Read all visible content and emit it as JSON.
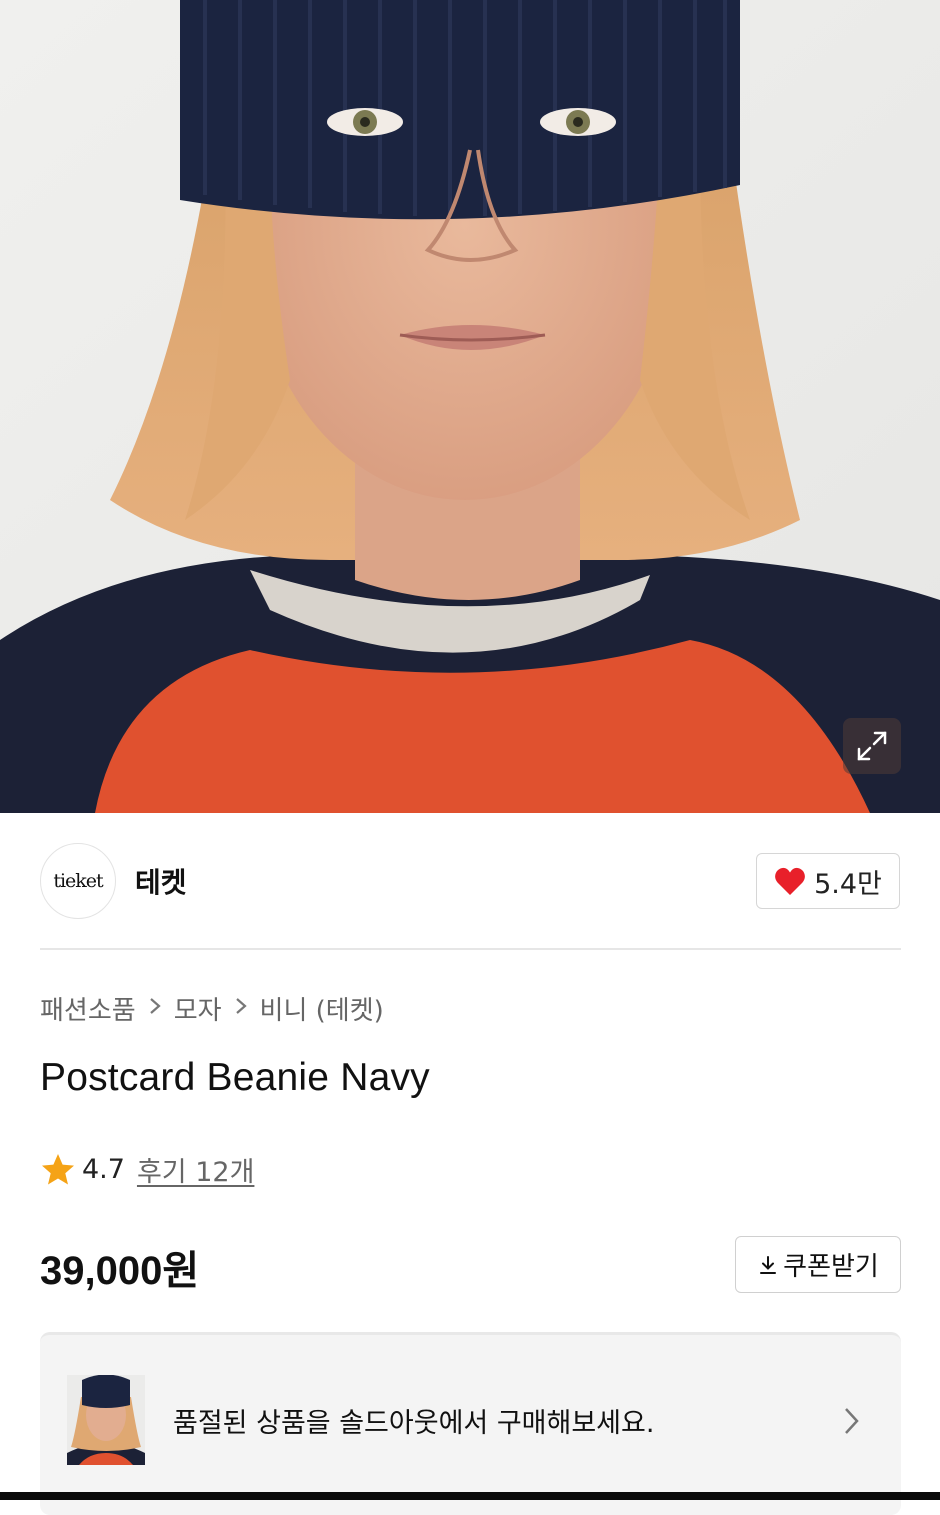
{
  "brand": {
    "logo_text": "tieket",
    "name": "테켓"
  },
  "like": {
    "count": "5.4만"
  },
  "breadcrumb": {
    "items": [
      "패션소품",
      "모자",
      "비니 (테켓)"
    ]
  },
  "product": {
    "title": "Postcard Beanie Navy",
    "rating": "4.7",
    "reviews": "후기 12개",
    "price": "39,000원"
  },
  "coupon": {
    "label": "쿠폰받기"
  },
  "soldout": {
    "message": "품절된 상품을 솔드아웃에서 구매해보세요."
  },
  "colors": {
    "heart": "#e8202a",
    "star": "#f5a316",
    "beanie": "#1b2440",
    "shirt_orange": "#e0512f",
    "shirt_navy": "#1c2136"
  },
  "icons": {
    "expand": "expand-icon",
    "heart": "heart-icon",
    "star": "star-icon",
    "download": "download-icon",
    "chevron": "chevron-right-icon"
  }
}
